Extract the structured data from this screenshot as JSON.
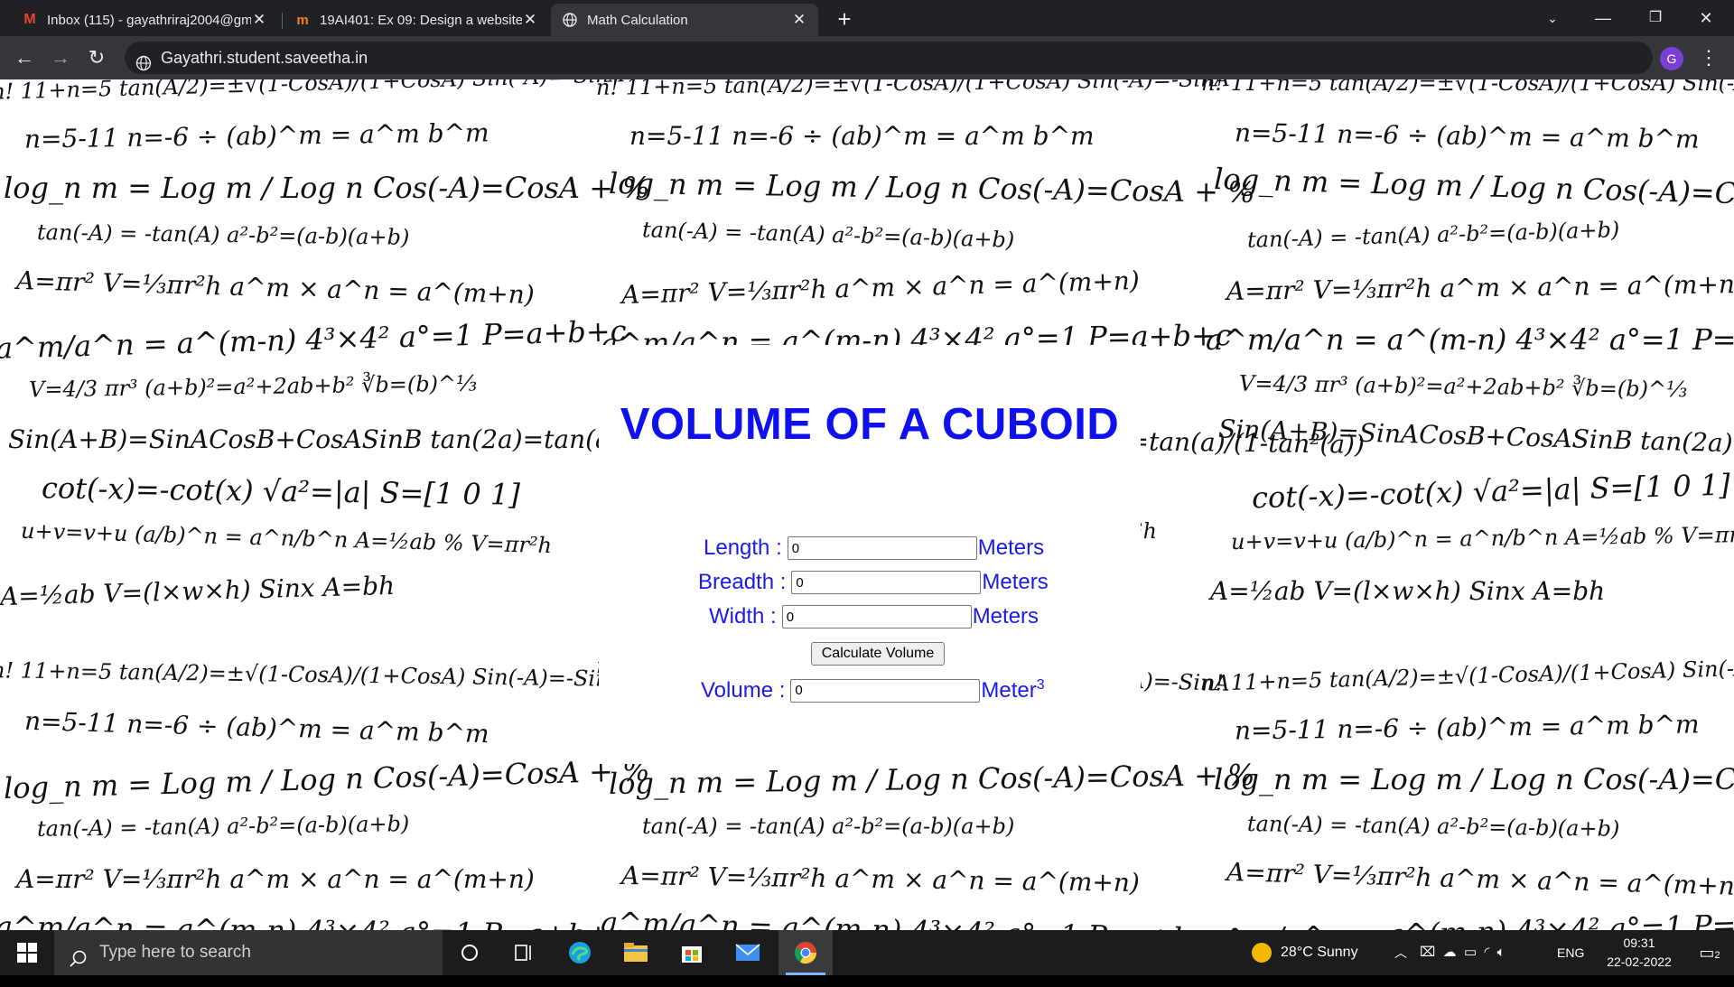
{
  "browser": {
    "tabs": [
      {
        "label": "Inbox (115) - gayathriraj2004@gmail.com",
        "favicon": "gmail-icon"
      },
      {
        "label": "19AI401: Ex 09: Design a website",
        "favicon": "moodle-icon"
      },
      {
        "label": "Math Calculation",
        "favicon": "globe-icon",
        "active": true
      }
    ],
    "url": "Gayathri.student.saveetha.in",
    "profile_initial": "G"
  },
  "page": {
    "heading": "VOLUME OF A CUBOID",
    "fields": [
      {
        "label": "Length :",
        "value": "0",
        "unit": "Meters"
      },
      {
        "label": "Breadth :",
        "value": "0",
        "unit": "Meters"
      },
      {
        "label": "Width :",
        "value": "0",
        "unit": "Meters"
      }
    ],
    "button": "Calculate Volume",
    "result": {
      "label": "Volume :",
      "value": "0",
      "unit": "Meter",
      "unit_exp": "3"
    },
    "background_formulas": [
      "n! 11+n=5  tan(A/2)=±√(1-CosA)/(1+CosA)  Sin(-A)=-SinA",
      "n=5-11  n=-6 ÷  (ab)^m = a^m b^m",
      "log_n m = Log m / Log n   Cos(-A)=CosA  + %",
      "tan(-A) = -tan(A)   a²-b²=(a-b)(a+b)",
      "A=πr²  V=⅓πr²h   a^m × a^n = a^(m+n)",
      "a^m/a^n = a^(m-n)  4³×4²  a°=1   P=a+b+c",
      "V=4/3 πr³  (a+b)²=a²+2ab+b²  ∛b=(b)^⅓",
      "Sin(A+B)=SinACosB+CosASinB   tan(2a)=tan(a)/(1-tan²(a))",
      "cot(-x)=-cot(x)   √a²=|a|   S=[1 0 1]",
      "u+v=v+u   (a/b)^n = a^n/b^n   A=½ab %  V=πr²h",
      "A=½ab  V=(l×w×h)  Sinx  A=bh"
    ]
  },
  "taskbar": {
    "search_placeholder": "Type here to search",
    "weather": "28°C  Sunny",
    "language": "ENG",
    "time": "09:31",
    "date": "22-02-2022",
    "notifications": "2"
  }
}
